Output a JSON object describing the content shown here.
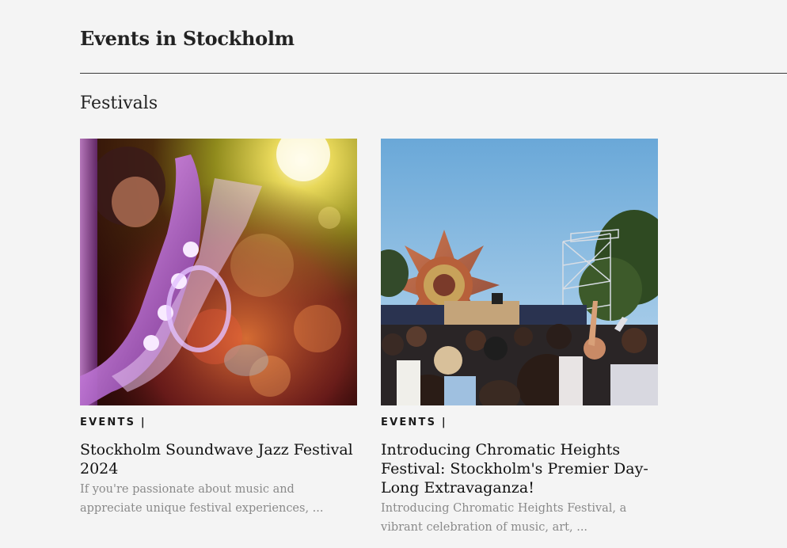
{
  "page": {
    "title": "Events in Stockholm",
    "section_title": "Festivals"
  },
  "cards": [
    {
      "category": "EVENTS |",
      "title": "Stockholm Soundwave Jazz Festival 2024",
      "excerpt": "If you're passionate about music and appreciate unique festival experiences, ...",
      "image_icon": "saxophone-photo"
    },
    {
      "category": "EVENTS |",
      "title": "Introducing Chromatic Heights Festival: Stockholm's Premier Day-Long Extravaganza!",
      "excerpt": "Introducing Chromatic Heights Festival, a vibrant celebration of music, art, ...",
      "image_icon": "festival-crowd-photo"
    }
  ]
}
